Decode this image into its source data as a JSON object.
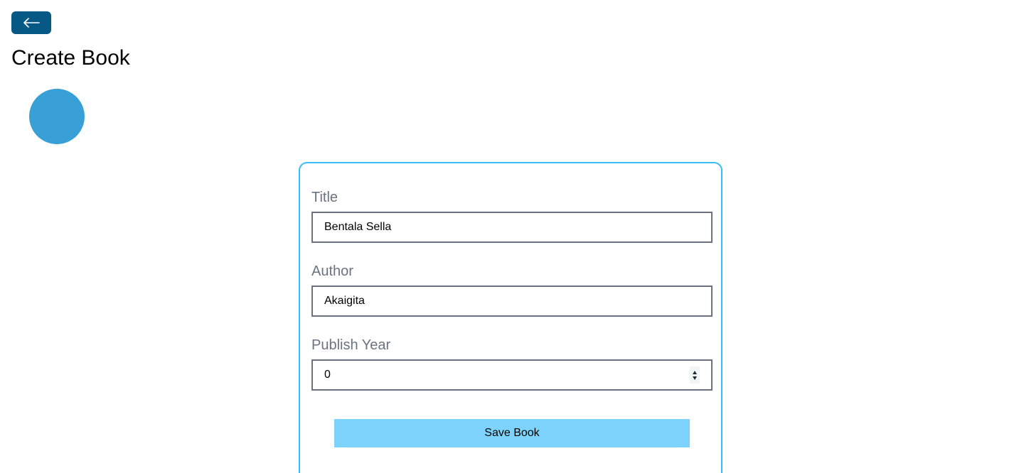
{
  "header": {
    "back_icon": "arrow-left-icon",
    "title": "Create Book"
  },
  "loader": {
    "icon": "spinner-circle",
    "color": "#38a0d6"
  },
  "form": {
    "title": {
      "label": "Title",
      "value": "Bentala Sella"
    },
    "author": {
      "label": "Author",
      "value": "Akaigita"
    },
    "publish_year": {
      "label": "Publish Year",
      "value": "0"
    },
    "save_label": "Save Book"
  },
  "colors": {
    "back_button": "#075985",
    "card_border": "#38bdf8",
    "save_button": "#7dd3fc",
    "label_text": "#6b7280"
  }
}
